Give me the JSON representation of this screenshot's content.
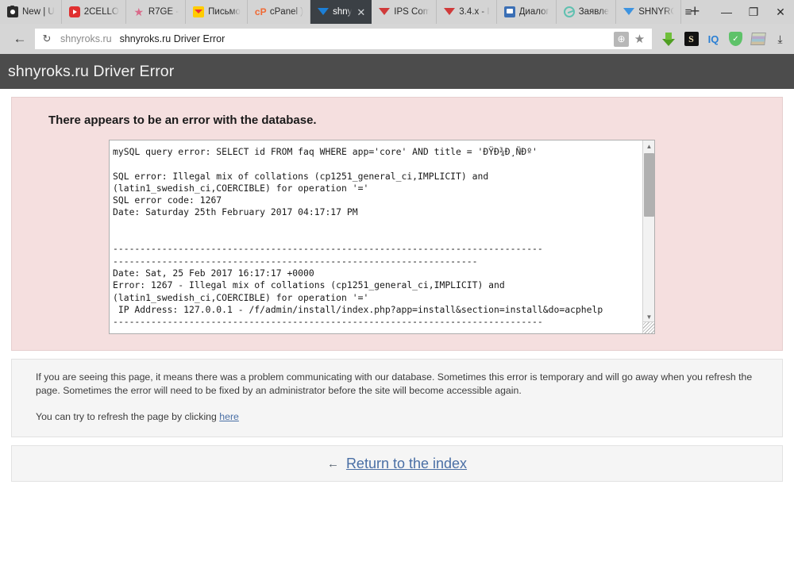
{
  "browser": {
    "tabs": [
      {
        "label": "New | U",
        "icon": "camera-icon",
        "active": false
      },
      {
        "label": "2CELLO",
        "icon": "youtube-icon",
        "active": false
      },
      {
        "label": "R7GE -",
        "icon": "star-icon",
        "active": false
      },
      {
        "label": "Письмо",
        "icon": "yandex-mail-icon",
        "active": false
      },
      {
        "label": "cPanel )",
        "icon": "cpanel-icon",
        "active": false
      },
      {
        "label": "shny",
        "icon": "invision-icon",
        "active": true
      },
      {
        "label": "IPS Com",
        "icon": "invision-red-icon",
        "active": false
      },
      {
        "label": "3.4.x - I",
        "icon": "invision-red-icon",
        "active": false
      },
      {
        "label": "Диалог",
        "icon": "chat-icon",
        "active": false
      },
      {
        "label": "Заявле",
        "icon": "circle-arrow-icon",
        "active": false
      },
      {
        "label": "SHNYRO",
        "icon": "invision-blue-icon",
        "active": false
      }
    ],
    "new_tab_label": "+",
    "window_controls": {
      "menu": "≡",
      "minimize": "—",
      "maximize": "❐",
      "close": "✕"
    },
    "nav": {
      "back": "←",
      "reload": "↻",
      "omnibox_domain": "shnyroks.ru",
      "omnibox_title": "shnyroks.ru Driver Error",
      "globe_badge": "⊕",
      "bookmark_star": "★"
    },
    "extensions": [
      {
        "name": "download-manager-icon",
        "label": ""
      },
      {
        "name": "savefrom-icon",
        "label": "S"
      },
      {
        "name": "iq-icon",
        "label": "IQ"
      },
      {
        "name": "adguard-shield-icon",
        "label": "✓"
      },
      {
        "name": "winrar-icon",
        "label": ""
      },
      {
        "name": "downloads-tray-icon",
        "label": "⤓"
      }
    ]
  },
  "page": {
    "header_title": "shnyroks.ru Driver Error",
    "error": {
      "heading": "There appears to be an error with the database.",
      "log": "mySQL query error: SELECT id FROM faq WHERE app='core' AND title = 'ÐŸÐ¾Ð¸ÑÐº'\n\nSQL error: Illegal mix of collations (cp1251_general_ci,IMPLICIT) and\n(latin1_swedish_ci,COERCIBLE) for operation '='\nSQL error code: 1267\nDate: Saturday 25th February 2017 04:17:17 PM\n\n\n-------------------------------------------------------------------------------\n-------------------------------------------------------------------\nDate: Sat, 25 Feb 2017 16:17:17 +0000\nError: 1267 - Illegal mix of collations (cp1251_general_ci,IMPLICIT) and\n(latin1_swedish_ci,COERCIBLE) for operation '='\n IP Address: 127.0.0.1 - /f/admin/install/index.php?app=install&section=install&do=acphelp\n-------------------------------------------------------------------------------\n-------------------------------------------------------------------\nmySQL query error: SELECT id FROM faq WHERE app='core' AND title = 'ÐŸÐ¾Ð¸ÑÐº'"
    },
    "info": {
      "paragraph_1": "If you are seeing this page, it means there was a problem communicating with our database. Sometimes this error is temporary and will go away when you refresh the page. Sometimes the error will need to be fixed by an administrator before the site will become accessible again.",
      "paragraph_2_prefix": "You can try to refresh the page by clicking ",
      "refresh_link": "here"
    },
    "index": {
      "arrow": "←",
      "link": "Return to the index"
    }
  },
  "colors": {
    "error_bg": "#f5dfdf",
    "header_bg": "#4c4c4c",
    "link": "#4a6fa5",
    "active_tab_bg": "#3b4045"
  }
}
